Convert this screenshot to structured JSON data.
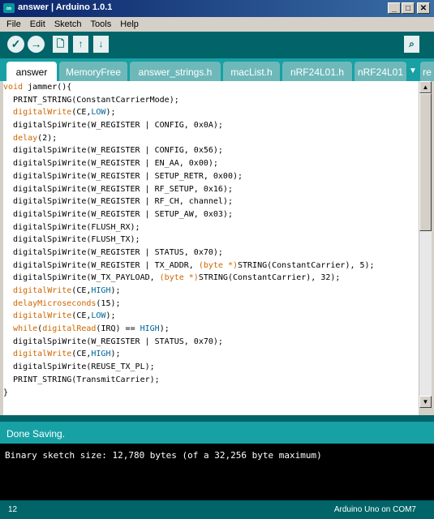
{
  "window": {
    "title": "answer | Arduino 1.0.1",
    "icon_text": "∞",
    "minimize": "_",
    "maximize": "□",
    "close": "✕"
  },
  "menu": {
    "items": [
      "File",
      "Edit",
      "Sketch",
      "Tools",
      "Help"
    ]
  },
  "toolbar": {
    "verify": "✓",
    "upload": "→",
    "new": "🗋",
    "open": "↑",
    "save": "↓",
    "serial_monitor": "⌕"
  },
  "tabs": [
    {
      "label": "answer",
      "active": true
    },
    {
      "label": "MemoryFree"
    },
    {
      "label": "answer_strings.h"
    },
    {
      "label": "macList.h"
    },
    {
      "label": "nRF24L01.h"
    },
    {
      "label": "nRF24L01"
    },
    {
      "label": "re"
    }
  ],
  "tab_menu_icon": "▼",
  "code": {
    "lines": [
      [
        {
          "t": "void",
          "c": "kw-type"
        },
        {
          "t": " jammer(){"
        }
      ],
      [
        {
          "t": "  PRINT_STRING(ConstantCarrierMode);"
        }
      ],
      [
        {
          "t": "  "
        },
        {
          "t": "digitalWrite",
          "c": "kw-fn"
        },
        {
          "t": "(CE,"
        },
        {
          "t": "LOW",
          "c": "const"
        },
        {
          "t": ");"
        }
      ],
      [
        {
          "t": "  digitalSpiWrite(W_REGISTER | CONFIG, 0x0A);"
        }
      ],
      [
        {
          "t": "  "
        },
        {
          "t": "delay",
          "c": "kw-fn"
        },
        {
          "t": "(2);"
        }
      ],
      [
        {
          "t": "  digitalSpiWrite(W_REGISTER | CONFIG, 0x56);"
        }
      ],
      [
        {
          "t": "  digitalSpiWrite(W_REGISTER | EN_AA, 0x00);"
        }
      ],
      [
        {
          "t": "  digitalSpiWrite(W_REGISTER | SETUP_RETR, 0x00);"
        }
      ],
      [
        {
          "t": "  digitalSpiWrite(W_REGISTER | RF_SETUP, 0x16);"
        }
      ],
      [
        {
          "t": "  digitalSpiWrite(W_REGISTER | RF_CH, channel);"
        }
      ],
      [
        {
          "t": "  digitalSpiWrite(W_REGISTER | SETUP_AW, 0x03);"
        }
      ],
      [
        {
          "t": "  digitalSpiWrite(FLUSH_RX);"
        }
      ],
      [
        {
          "t": "  digitalSpiWrite(FLUSH_TX);"
        }
      ],
      [
        {
          "t": "  digitalSpiWrite(W_REGISTER | STATUS, 0x70);"
        }
      ],
      [
        {
          "t": "  digitalSpiWrite(W_REGISTER | TX_ADDR, "
        },
        {
          "t": "(byte *)",
          "c": "kw-type"
        },
        {
          "t": "STRING(ConstantCarrier), 5);"
        }
      ],
      [
        {
          "t": "  digitalSpiWrite(W_TX_PAYLOAD, "
        },
        {
          "t": "(byte *)",
          "c": "kw-type"
        },
        {
          "t": "STRING(ConstantCarrier), 32);"
        }
      ],
      [
        {
          "t": "  "
        },
        {
          "t": "digitalWrite",
          "c": "kw-fn"
        },
        {
          "t": "(CE,"
        },
        {
          "t": "HIGH",
          "c": "const"
        },
        {
          "t": ");"
        }
      ],
      [
        {
          "t": "  "
        },
        {
          "t": "delayMicroseconds",
          "c": "kw-fn"
        },
        {
          "t": "(15);"
        }
      ],
      [
        {
          "t": "  "
        },
        {
          "t": "digitalWrite",
          "c": "kw-fn"
        },
        {
          "t": "(CE,"
        },
        {
          "t": "LOW",
          "c": "const"
        },
        {
          "t": ");"
        }
      ],
      [
        {
          "t": "  "
        },
        {
          "t": "while",
          "c": "kw-fn"
        },
        {
          "t": "("
        },
        {
          "t": "digitalRead",
          "c": "kw-fn"
        },
        {
          "t": "(IRQ) == "
        },
        {
          "t": "HIGH",
          "c": "const"
        },
        {
          "t": ");"
        }
      ],
      [
        {
          "t": "  digitalSpiWrite(W_REGISTER | STATUS, 0x70);"
        }
      ],
      [
        {
          "t": "  "
        },
        {
          "t": "digitalWrite",
          "c": "kw-fn"
        },
        {
          "t": "(CE,"
        },
        {
          "t": "HIGH",
          "c": "const"
        },
        {
          "t": ");"
        }
      ],
      [
        {
          "t": "  digitalSpiWrite(REUSE_TX_PL);"
        }
      ],
      [
        {
          "t": "  PRINT_STRING(TransmitCarrier);"
        }
      ],
      [
        {
          "t": "}"
        }
      ]
    ]
  },
  "status": {
    "message": "Done Saving."
  },
  "console": {
    "text": "Binary sketch size: 12,780 bytes (of a 32,256 byte maximum)"
  },
  "footer": {
    "line_number": "12",
    "board": "Arduino Uno on COM7"
  },
  "colors": {
    "toolbar": "#006468",
    "tabbar": "#17a1a5",
    "keyword": "#cc6600",
    "constant": "#006699"
  }
}
